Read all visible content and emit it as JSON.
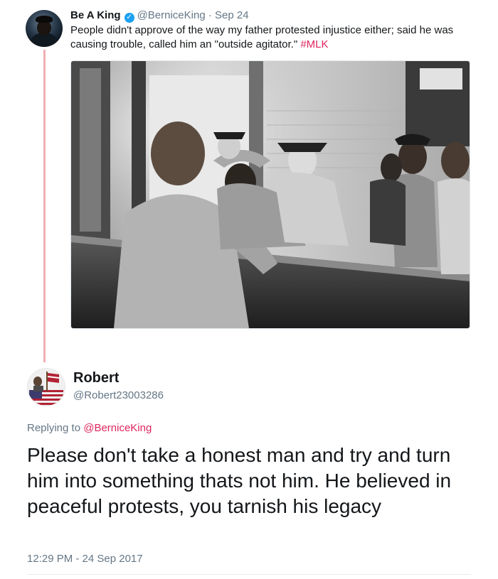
{
  "parent_tweet": {
    "display_name": "Be A King",
    "verified_icon": "verified-badge-icon",
    "handle": "@BerniceKing",
    "separator": "·",
    "date": "Sep 24",
    "text_part1": "People didn't approve of the way my father protested injustice either; said he was causing trouble, called him an \"outside agitator.\" ",
    "hashtag": "#MLK",
    "colors": {
      "hashtag": "#e0245e",
      "thread_line": "#f0aeb2",
      "verified": "#1da1f2"
    }
  },
  "reply": {
    "display_name": "Robert",
    "handle": "@Robert23003286",
    "replying_prefix": "Replying to ",
    "replying_to": "@BerniceKing",
    "text": "Please don't take a honest man and try and turn him into something thats not him. He believed in peaceful protests, you tarnish his legacy",
    "timestamp": "12:29 PM - 24 Sep 2017"
  }
}
